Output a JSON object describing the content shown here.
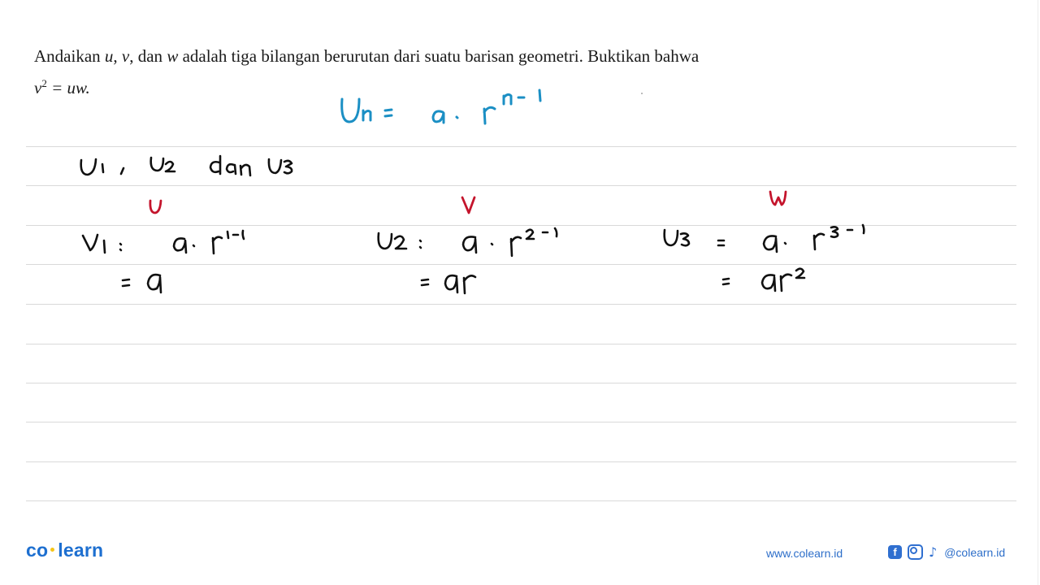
{
  "question": {
    "text_prefix": "Andaikan ",
    "var_u": "u",
    "sep1": ", ",
    "var_v": "v",
    "sep2": ", dan ",
    "var_w": "w",
    "text_mid": " adalah tiga bilangan berurutan dari suatu barisan geometri. Buktikan bahwa",
    "equation_lhs": "v",
    "equation_exp": "2",
    "equation_rhs": " = uw."
  },
  "handwriting": {
    "formula": "Un = a · r^(n−1)",
    "terms_line": "U1 , U2 dan U3",
    "labels": {
      "u": "u",
      "v": "v",
      "w": "w"
    },
    "u1_line": "U1 = a · r^(1−1)",
    "u1_result": "= a",
    "u2_line": "U2 = a · r^(2−1)",
    "u2_result": "= ar",
    "u3_line": "U3 = a · r^(3−1)",
    "u3_result": "= ar²"
  },
  "colors": {
    "formula_ink": "#1b8fc4",
    "work_ink": "#111111",
    "label_ink": "#c4142c",
    "brand": "#1d6fd0"
  },
  "footer": {
    "logo_left": "co",
    "logo_right": "learn",
    "url": "www.colearn.id",
    "social_icons": [
      "facebook-icon",
      "instagram-icon",
      "tiktok-icon"
    ],
    "facebook_glyph": "f",
    "tiktok_glyph": "♪",
    "handle": "@colearn.id"
  }
}
